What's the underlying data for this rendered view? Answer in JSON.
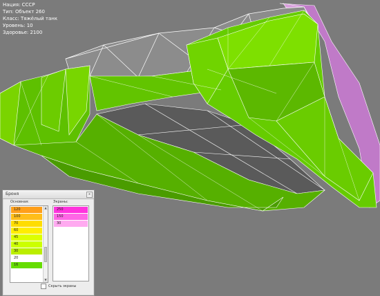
{
  "info": {
    "nation": "Нация: СССР",
    "type": "Тип: Объект 260",
    "class": "Класс: Тяжёлый танк",
    "level": "Уровень: 10",
    "health": "Здоровье: 2100"
  },
  "armor_panel": {
    "title": "Броня",
    "close_glyph": "x",
    "base_label": "Основная:",
    "screens_label": "Экраны:",
    "hide_screens_label": "Скрыть экраны",
    "base_rows": [
      {
        "value": "120",
        "color": "#ff9f1a"
      },
      {
        "value": "100",
        "color": "#ffbe1a"
      },
      {
        "value": "70",
        "color": "#ffdd00"
      },
      {
        "value": "60",
        "color": "#ffee00"
      },
      {
        "value": "45",
        "color": "#ddff00"
      },
      {
        "value": "40",
        "color": "#ccff00"
      },
      {
        "value": "30",
        "color": "#bbee00"
      },
      {
        "value": "20",
        "color": "#ffffff"
      },
      {
        "value": "16",
        "color": "#66dd00"
      }
    ],
    "screen_rows": [
      {
        "value": "250",
        "color": "#ff33dd"
      },
      {
        "value": "150",
        "color": "#ff66e6"
      },
      {
        "value": "30",
        "color": "#ffaaf0"
      }
    ],
    "scroll_position": 0.7
  },
  "colors": {
    "background": "#7b7b7b",
    "armor_16": "#66dd00",
    "screens": "#cc77cc",
    "inner": "#5a5a5a"
  }
}
